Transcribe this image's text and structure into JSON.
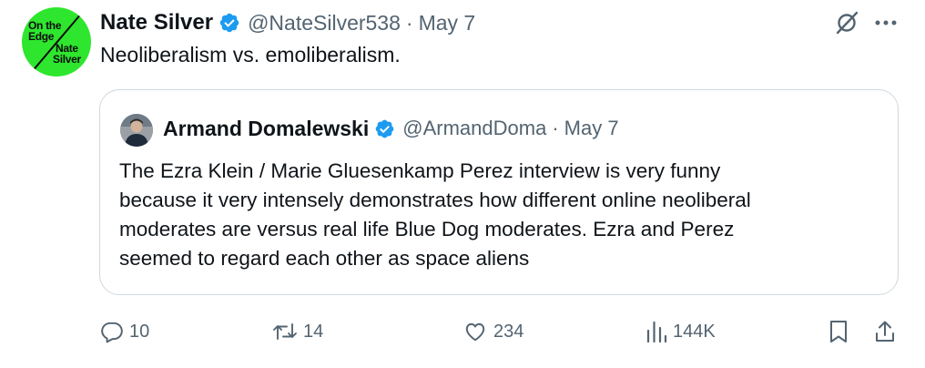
{
  "colors": {
    "avatar_green": "#2ee62e",
    "verified_blue": "#1d9bf0",
    "secondary_text": "#536471",
    "border": "#cfd9de"
  },
  "tweet": {
    "avatar": {
      "line1": "On the",
      "line2": "Edge",
      "line3": "Nate",
      "line4": "Silver"
    },
    "author_name": "Nate Silver",
    "handle": "@NateSilver538",
    "separator": "·",
    "date": "May 7",
    "text": "Neoliberalism vs. emoliberalism.",
    "icons": [
      "verified-badge-icon",
      "grok-icon",
      "more-icon"
    ]
  },
  "quoted_tweet": {
    "author_name": "Armand Domalewski",
    "handle": "@ArmandDoma",
    "separator": "·",
    "date": "May 7",
    "lines": [
      "The Ezra Klein / Marie Gluesenkamp Perez interview is very funny",
      "because it very intensely demonstrates how different online neoliberal",
      "moderates are versus real life Blue Dog moderates. Ezra and Perez",
      "seemed to regard each other as space aliens"
    ]
  },
  "actions": {
    "replies": "10",
    "reposts": "14",
    "likes": "234",
    "views": "144K",
    "icons": [
      "reply-icon",
      "retweet-icon",
      "like-icon",
      "views-icon",
      "bookmark-icon",
      "share-icon"
    ]
  }
}
